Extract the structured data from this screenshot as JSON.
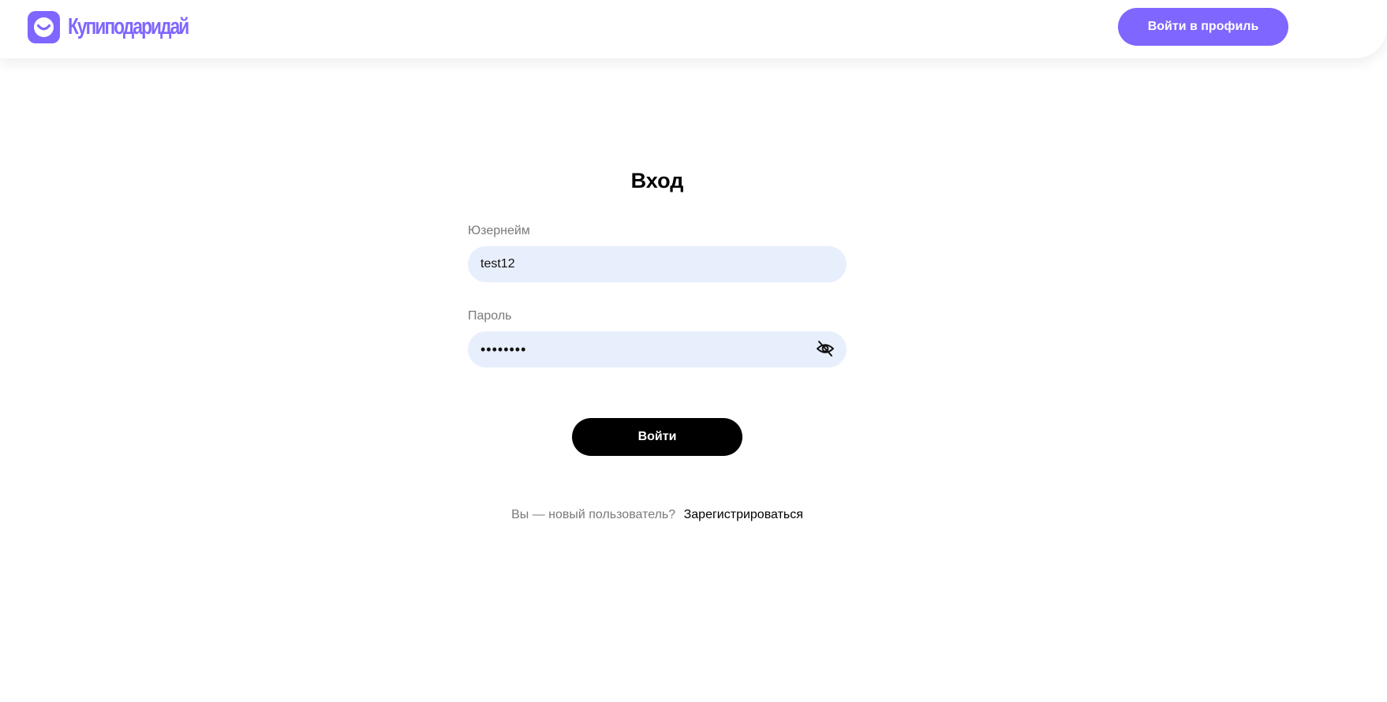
{
  "header": {
    "logo_text": "Купиподаридай",
    "profile_button_label": "Войти в профиль"
  },
  "login": {
    "title": "Вход",
    "username": {
      "label": "Юзернейм",
      "value": "test12"
    },
    "password": {
      "label": "Пароль",
      "value": "••••••••",
      "toggle_icon": "eye-off-icon"
    },
    "submit_label": "Войти",
    "register_prompt": "Вы — новый пользователь?",
    "register_link": "Зарегистрироваться"
  },
  "colors": {
    "brand": "#7f66ff",
    "input_bg": "#e8effc",
    "primary_button": "#000000",
    "muted_text": "#7a7a7a"
  }
}
